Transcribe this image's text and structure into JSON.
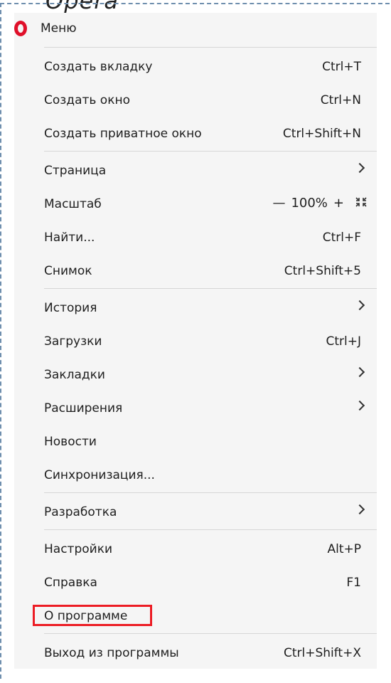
{
  "cut_title": "Opera",
  "menu": {
    "title": "Меню",
    "groups": [
      [
        {
          "label": "Создать вкладку",
          "shortcut": "Ctrl+T"
        },
        {
          "label": "Создать окно",
          "shortcut": "Ctrl+N"
        },
        {
          "label": "Создать приватное окно",
          "shortcut": "Ctrl+Shift+N"
        }
      ],
      [
        {
          "label": "Страница",
          "submenu": true
        },
        {
          "label": "Масштаб",
          "zoom": {
            "minus": "—",
            "value": "100%",
            "plus": "+",
            "fullscreen_icon": "fullscreen-icon"
          }
        },
        {
          "label": "Найти...",
          "shortcut": "Ctrl+F"
        },
        {
          "label": "Снимок",
          "shortcut": "Ctrl+Shift+5"
        }
      ],
      [
        {
          "label": "История",
          "submenu": true
        },
        {
          "label": "Загрузки",
          "shortcut": "Ctrl+J"
        },
        {
          "label": "Закладки",
          "submenu": true
        },
        {
          "label": "Расширения",
          "submenu": true
        },
        {
          "label": "Новости"
        },
        {
          "label": "Синхронизация..."
        }
      ],
      [
        {
          "label": "Разработка",
          "submenu": true
        }
      ],
      [
        {
          "label": "Настройки",
          "shortcut": "Alt+P"
        },
        {
          "label": "Справка",
          "shortcut": "F1"
        },
        {
          "label": "О программе",
          "highlighted": true
        }
      ],
      [
        {
          "label": "Выход из программы",
          "shortcut": "Ctrl+Shift+X"
        }
      ]
    ]
  },
  "colors": {
    "logo": "#e0102a",
    "highlight": "#ec1c24",
    "menu_bg": "#f5f5f5"
  }
}
